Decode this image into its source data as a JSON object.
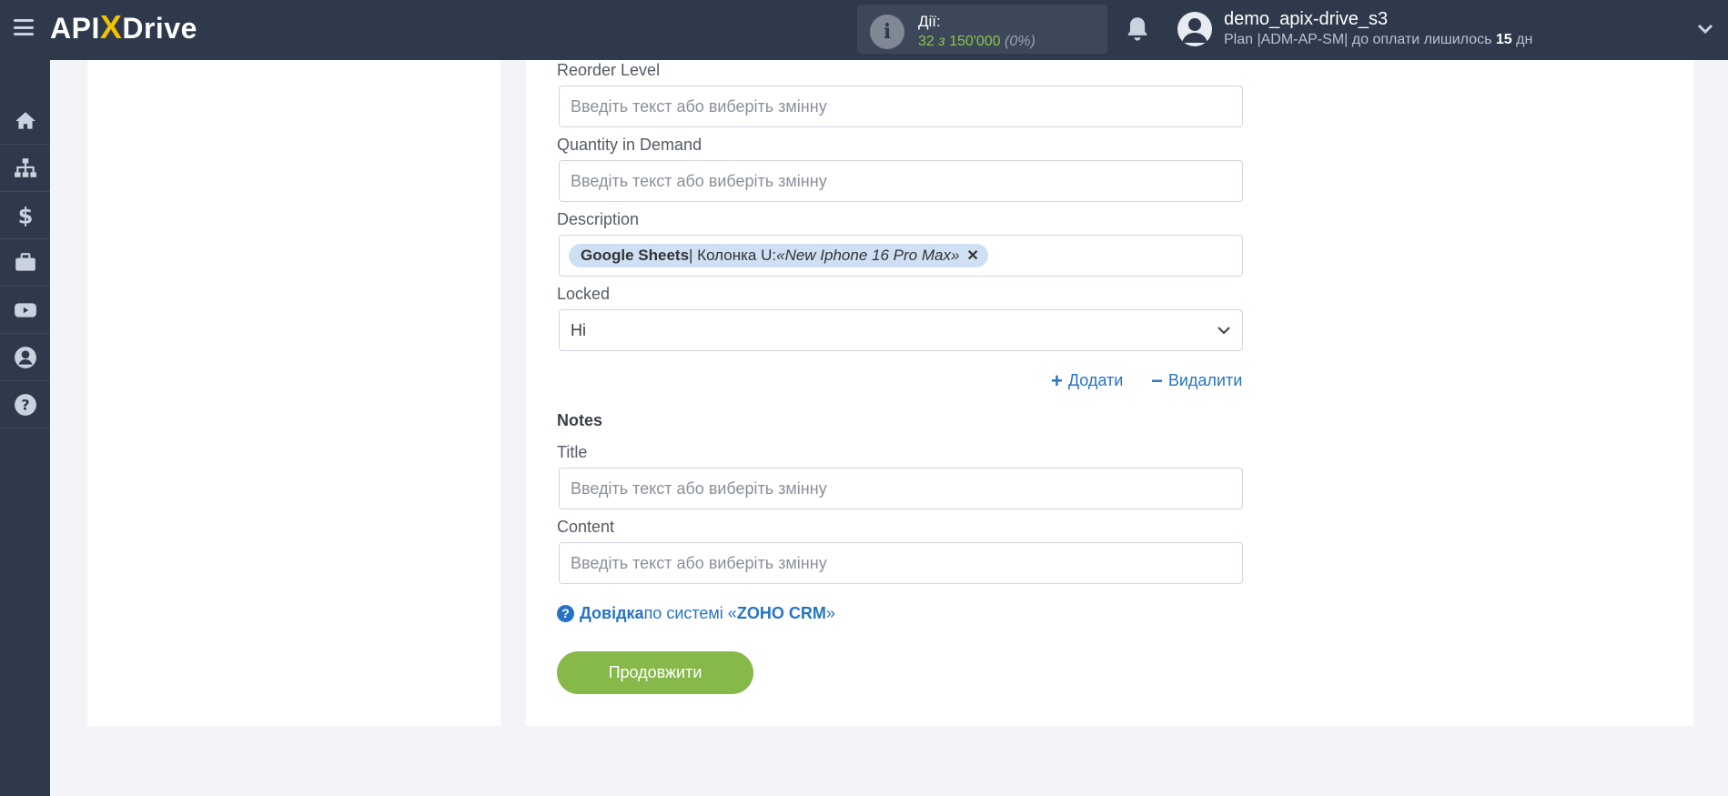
{
  "header": {
    "logo_left": "API",
    "logo_x": "X",
    "logo_right": "Drive",
    "actions_label": "Дії:",
    "actions_used": "32",
    "actions_sep": " з ",
    "actions_total": "150'000",
    "actions_pct": "(0%)",
    "user_name": "demo_apix-drive_s3",
    "plan_prefix": "Plan |ADM-AP-SM| до оплати лишилось ",
    "plan_days": "15",
    "plan_suffix": " дн"
  },
  "sidebar": {
    "items": [
      "home-icon",
      "sitemap-icon",
      "dollar-icon",
      "briefcase-icon",
      "youtube-icon",
      "user-circle-icon",
      "help-icon"
    ]
  },
  "form": {
    "placeholder": "Введіть текст або виберіть змінну",
    "reorder_level_label": "Reorder Level",
    "quantity_demand_label": "Quantity in Demand",
    "description_label": "Description",
    "description_tag": {
      "source": "Google Sheets",
      "sep": " | Колонка U: ",
      "value": "«New Iphone 16 Pro Max»"
    },
    "locked_label": "Locked",
    "locked_value": "Ні",
    "add_label": "Додати",
    "remove_label": "Видалити",
    "notes_title": "Notes",
    "title_label": "Title",
    "content_label": "Content",
    "help_bold": "Довідка",
    "help_middle": " по системі «",
    "help_system": "ZOHO CRM",
    "help_end": "»",
    "continue_label": "Продовжити"
  },
  "colors": {
    "topbar": "#2e3a4b",
    "accent_green": "#86b84a",
    "link_blue": "#2673c5",
    "logo_x": "#f2c200"
  }
}
